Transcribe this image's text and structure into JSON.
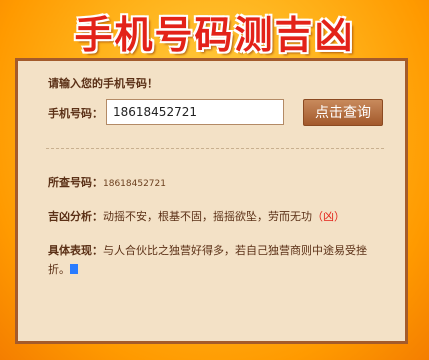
{
  "header": {
    "title": "手机号码测吉凶"
  },
  "form": {
    "prompt": "请输入您的手机号码！",
    "phone_label": "手机号码：",
    "phone_value": "18618452721",
    "query_button": "点击查询"
  },
  "result": {
    "queried_label": "所查号码：",
    "queried_value": "18618452721",
    "analysis_label": "吉凶分析：",
    "analysis_text": "动摇不安，根基不固，摇摇欲坠，劳而无功",
    "analysis_verdict": "（凶）",
    "detail_label": "具体表现：",
    "detail_text": "与人合伙比之独营好得多，若自己独营商则中途易受挫折。"
  },
  "colors": {
    "accent": "#e32219",
    "panel_bg": "#f3e1c6",
    "button": "#a3592c"
  }
}
